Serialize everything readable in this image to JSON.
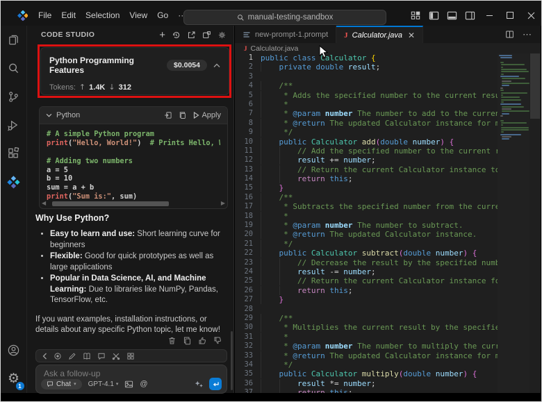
{
  "titlebar": {
    "menus": [
      "File",
      "Edit",
      "Selection",
      "View",
      "Go",
      "···"
    ],
    "search": "manual-testing-sandbox"
  },
  "sidebar": {
    "title": "CODE STUDIO",
    "card": {
      "title": "Python Programming Features",
      "cost": "$0.0054",
      "tokens_label": "Tokens:",
      "tokens_in": "1.4K",
      "tokens_out": "312"
    },
    "code_block": {
      "language": "Python",
      "apply_label": "Apply",
      "lines": [
        "# A simple Python program",
        "print(\"Hello, World!\")  # Prints Hello, World! to the screen",
        "",
        "# Adding two numbers",
        "a = 5",
        "b = 10",
        "sum = a + b",
        "print(\"Sum is:\", sum)"
      ]
    },
    "answer": {
      "heading": "Why Use Python?",
      "bullets": [
        {
          "bold": "Easy to learn and use:",
          "text": "Short learning curve for beginners"
        },
        {
          "bold": "Flexible:",
          "text": "Good for quick prototypes as well as large applications"
        },
        {
          "bold": "Popular in Data Science, AI, and Machine Learning:",
          "text": "Due to libraries like NumPy, Pandas, TensorFlow, etc."
        }
      ],
      "closing": "If you want examples, installation instructions, or details about any specific Python topic, let me know!"
    },
    "input": {
      "placeholder": "Ask a follow-up",
      "mode": "Chat",
      "model": "GPT-4.1"
    }
  },
  "editor": {
    "tabs": [
      {
        "label": "new-prompt-1.prompt"
      },
      {
        "label": "Calculator.java"
      }
    ],
    "breadcrumb": "Calculator.java",
    "code_lines": [
      "public class Calculator {",
      "    private double result;",
      "",
      "    /**",
      "     * Adds the specified number to the current result.",
      "     *",
      "     * @param number The number to add to the current result.",
      "     * @return The updated Calculator instance for method chaining.",
      "     */",
      "    public Calculator add(double number) {",
      "        // Add the specified number to the current result",
      "        result += number;",
      "        // Return the current Calculator instance to enable method chaining",
      "        return this;",
      "    }",
      "    /**",
      "     * Subtracts the specified number from the current result.",
      "     *",
      "     * @param number The number to subtract.",
      "     * @return The updated Calculator instance.",
      "     */",
      "    public Calculator subtract(double number) {",
      "        // Decrease the result by the specified number",
      "        result -= number;",
      "        // Return the current Calculator instance for method chaining",
      "        return this;",
      "    }",
      "",
      "    /**",
      "     * Multiplies the current result by the specified number.",
      "     *",
      "     * @param number The number to multiply the current result by.",
      "     * @return The updated Calculator instance for method chaining.",
      "     */",
      "    public Calculator multiply(double number) {",
      "        result *= number;",
      "        return this;"
    ]
  },
  "colors": {
    "accent": "#0078d4",
    "annotation": "#dd1111"
  }
}
